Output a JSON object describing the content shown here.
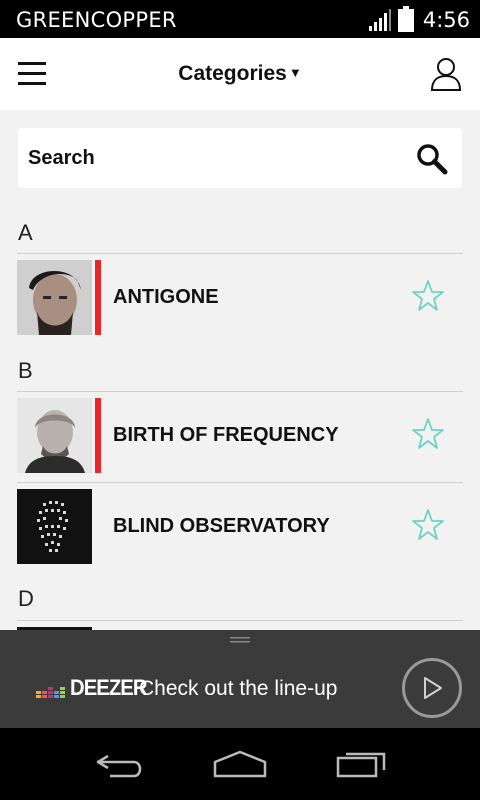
{
  "status_bar": {
    "carrier": "GREENCOPPER",
    "time": "4:56"
  },
  "app_bar": {
    "title": "Categories"
  },
  "search": {
    "label": "Search"
  },
  "sections": [
    {
      "letter": "A",
      "items": [
        {
          "label": "ANTIGONE",
          "highlighted": true
        }
      ]
    },
    {
      "letter": "B",
      "items": [
        {
          "label": "BIRTH OF FREQUENCY",
          "highlighted": true
        },
        {
          "label": "BLIND OBSERVATORY",
          "highlighted": false
        }
      ]
    },
    {
      "letter": "D",
      "items": []
    }
  ],
  "player": {
    "brand": "DEEZER",
    "promo": "Check out the line-up"
  },
  "colors": {
    "accent": "#e8262b",
    "star": "#6dd3c3",
    "player_bg": "#3b3b3b"
  }
}
